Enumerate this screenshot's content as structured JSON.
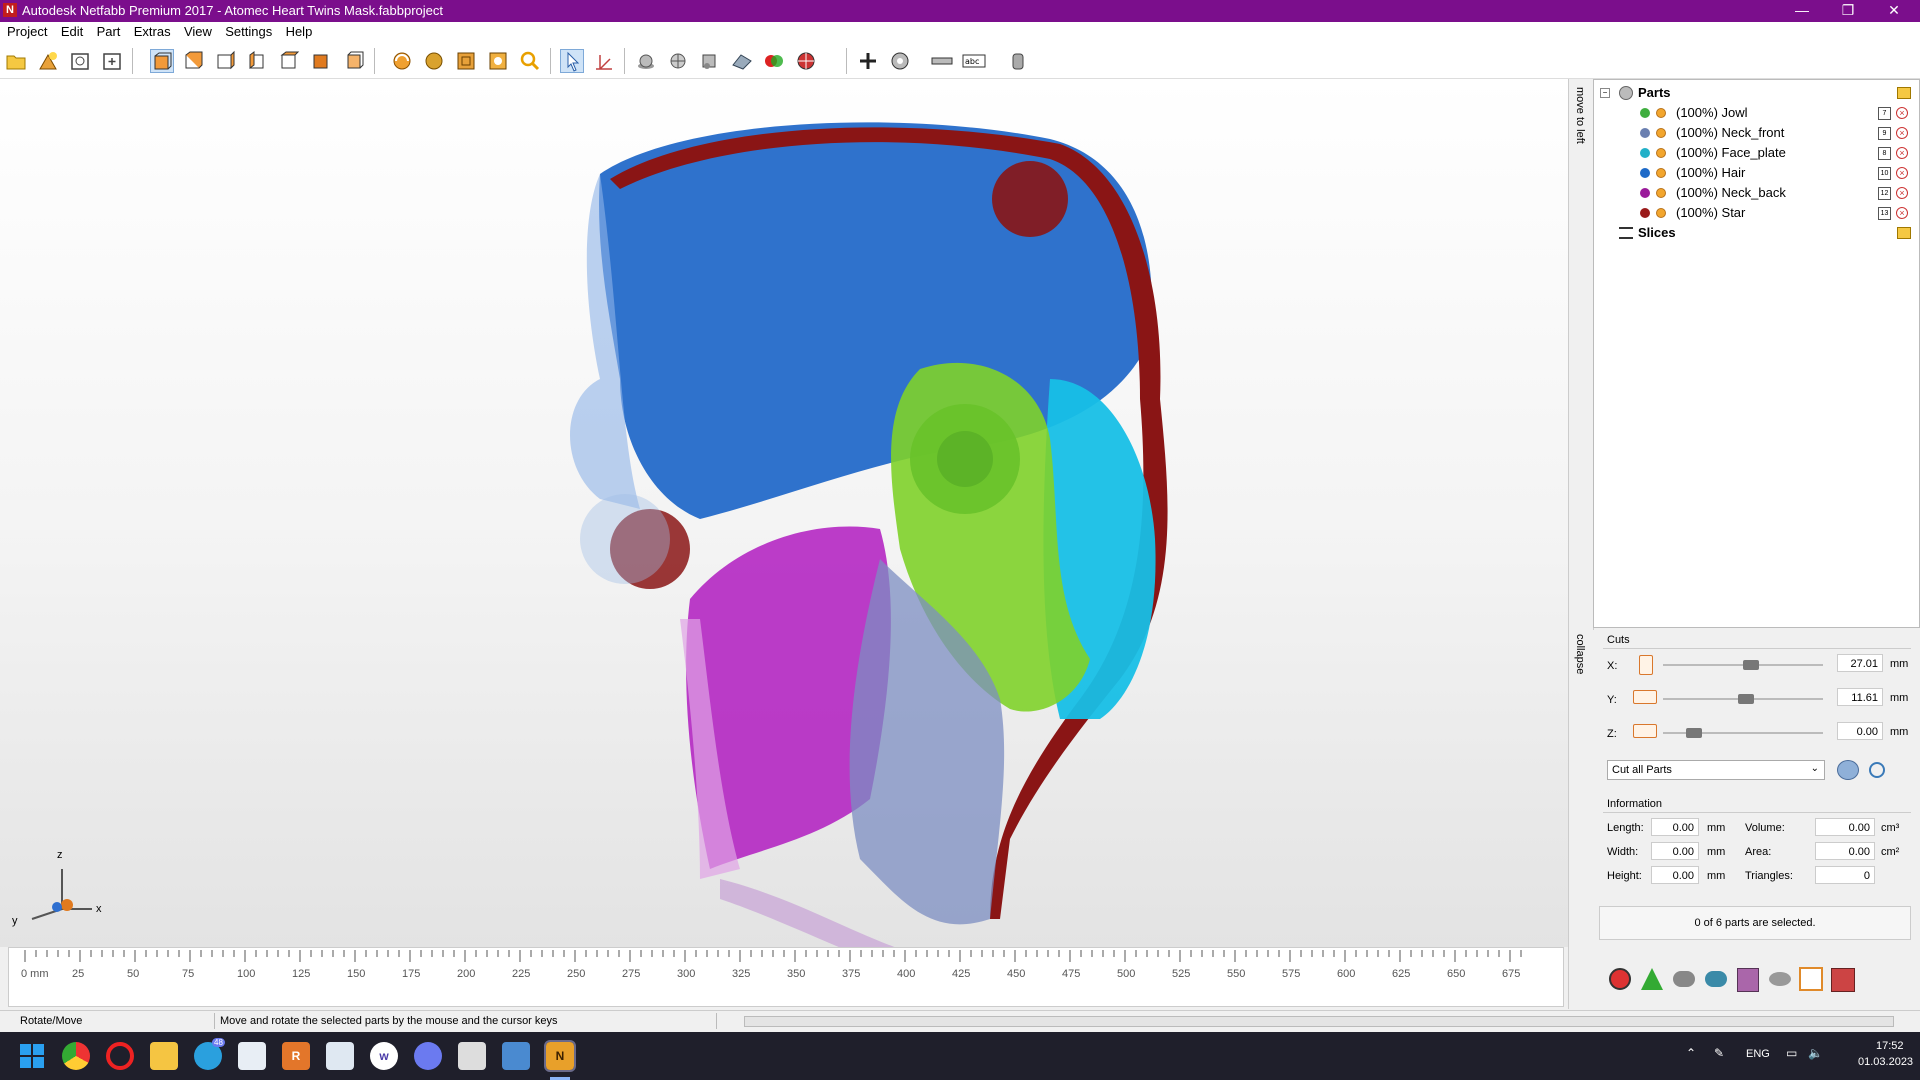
{
  "window": {
    "title": "Autodesk Netfabb Premium 2017 - Atomec Heart Twins Mask.fabbproject",
    "app_icon_letter": "N",
    "buttons": [
      "—",
      "❐",
      "✕"
    ]
  },
  "menu": [
    "Project",
    "Edit",
    "Part",
    "Extras",
    "View",
    "Settings",
    "Help"
  ],
  "toolbar": {
    "icons": [
      "open-project-icon",
      "add-part-icon",
      "import-icon",
      "new-icon",
      "view-front-icon",
      "view-back-icon",
      "view-left-icon",
      "view-right-icon",
      "view-top-icon",
      "view-bottom-icon",
      "view-iso-icon",
      "rotate-view-icon",
      "pan-view-icon",
      "zoom-fit-icon",
      "zoom-selection-icon",
      "zoom-icon",
      "select-pointer-icon",
      "move-tool-icon",
      "sphere-shade-icon",
      "sphere-wire-icon",
      "cube-icon",
      "mesh-icon",
      "color-icon",
      "sections-icon",
      "add-icon",
      "measure-icon",
      "ruler-icon",
      "label-icon",
      "settings-icon"
    ]
  },
  "side_strip": {
    "top_label": "move to left",
    "bottom_label": "collapse"
  },
  "tree": {
    "root": "Parts",
    "parts": [
      {
        "name": "(100%) Jowl",
        "color": "#3fae3f",
        "num": "7"
      },
      {
        "name": "(100%) Neck_front",
        "color": "#6a7fb0",
        "num": "9"
      },
      {
        "name": "(100%) Face_plate",
        "color": "#22b0c8",
        "num": "8"
      },
      {
        "name": "(100%) Hair",
        "color": "#1e6ac8",
        "num": "10"
      },
      {
        "name": "(100%) Neck_back",
        "color": "#9a1a9a",
        "num": "12"
      },
      {
        "name": "(100%) Star",
        "color": "#9a1a1a",
        "num": "13"
      }
    ],
    "slices": "Slices"
  },
  "cuts": {
    "title": "Cuts",
    "x_label": "X:",
    "x_value": "27.01",
    "y_label": "Y:",
    "y_value": "11.61",
    "z_label": "Z:",
    "z_value": "0.00",
    "unit": "mm",
    "mode": "Cut all Parts"
  },
  "information": {
    "title": "Information",
    "length_label": "Length:",
    "length": "0.00",
    "width_label": "Width:",
    "width": "0.00",
    "height_label": "Height:",
    "height": "0.00",
    "volume_label": "Volume:",
    "volume": "0.00",
    "area_label": "Area:",
    "area": "0.00",
    "triangles_label": "Triangles:",
    "triangles": "0",
    "mm": "mm",
    "cm3": "cm³",
    "cm2": "cm²",
    "selection": "0 of 6 parts are selected."
  },
  "ruler": {
    "first_label": "0 mm",
    "labels": [
      "25",
      "50",
      "75",
      "100",
      "125",
      "150",
      "175",
      "200",
      "225",
      "250",
      "275",
      "300",
      "325",
      "350",
      "375",
      "400",
      "425",
      "450",
      "475",
      "500",
      "525",
      "550",
      "575",
      "600",
      "625",
      "650",
      "675"
    ]
  },
  "axes": {
    "z": "z",
    "y": "y",
    "x": "x"
  },
  "status": {
    "mode": "Rotate/Move",
    "hint": "Move and rotate the selected parts by the mouse and the cursor keys"
  },
  "taskbar": {
    "apps": [
      "windows-start-icon",
      "chrome-icon",
      "opera-icon",
      "file-explorer-icon",
      "telegram-icon",
      "app-icon",
      "r-app-icon",
      "notepad-icon",
      "w-app-icon",
      "discord-icon",
      "zbrush-icon",
      "photos-icon",
      "netfabb-icon"
    ],
    "telegram_badge": "48",
    "lang": "ENG",
    "time": "17:52",
    "date": "01.03.2023"
  }
}
